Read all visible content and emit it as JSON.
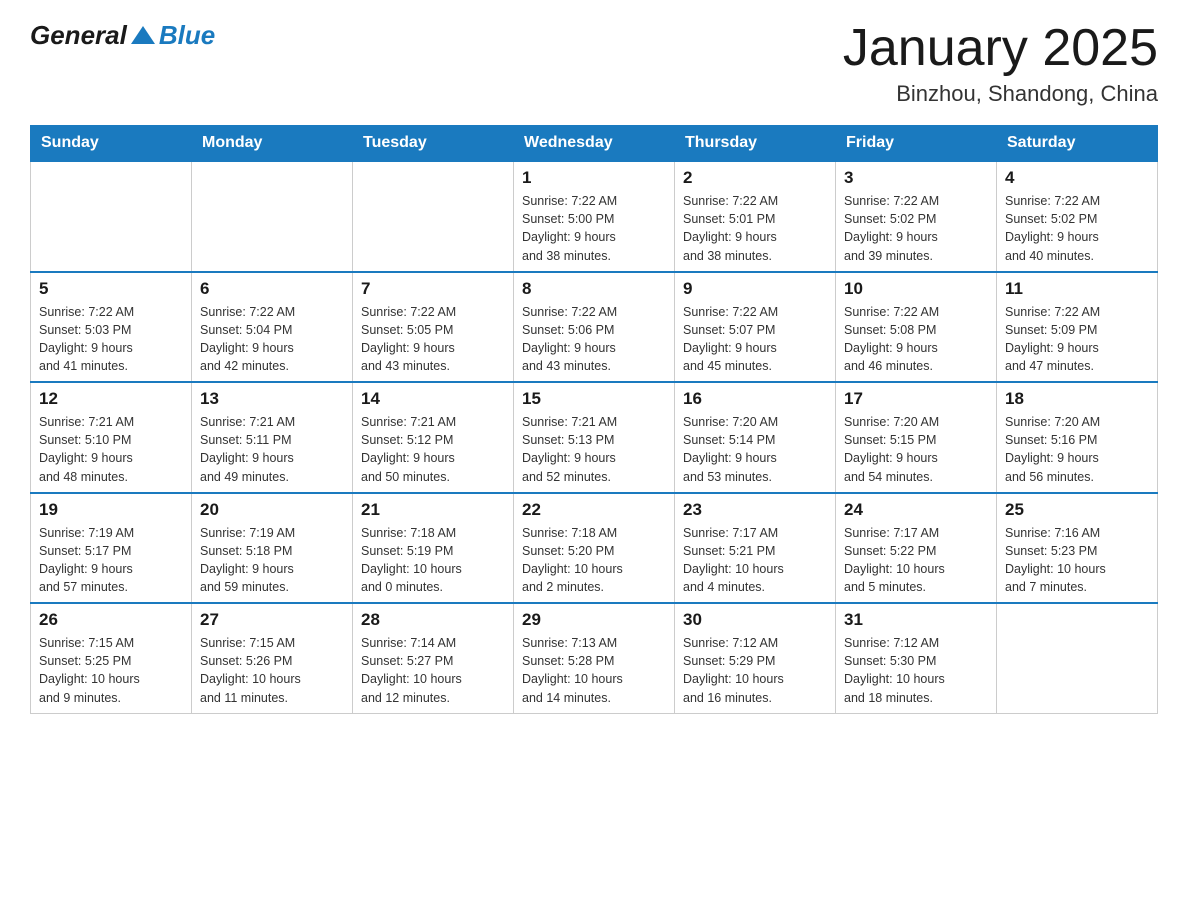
{
  "header": {
    "logo_general": "General",
    "logo_blue": "Blue",
    "title": "January 2025",
    "subtitle": "Binzhou, Shandong, China"
  },
  "weekdays": [
    "Sunday",
    "Monday",
    "Tuesday",
    "Wednesday",
    "Thursday",
    "Friday",
    "Saturday"
  ],
  "weeks": [
    [
      {
        "day": "",
        "info": ""
      },
      {
        "day": "",
        "info": ""
      },
      {
        "day": "",
        "info": ""
      },
      {
        "day": "1",
        "info": "Sunrise: 7:22 AM\nSunset: 5:00 PM\nDaylight: 9 hours\nand 38 minutes."
      },
      {
        "day": "2",
        "info": "Sunrise: 7:22 AM\nSunset: 5:01 PM\nDaylight: 9 hours\nand 38 minutes."
      },
      {
        "day": "3",
        "info": "Sunrise: 7:22 AM\nSunset: 5:02 PM\nDaylight: 9 hours\nand 39 minutes."
      },
      {
        "day": "4",
        "info": "Sunrise: 7:22 AM\nSunset: 5:02 PM\nDaylight: 9 hours\nand 40 minutes."
      }
    ],
    [
      {
        "day": "5",
        "info": "Sunrise: 7:22 AM\nSunset: 5:03 PM\nDaylight: 9 hours\nand 41 minutes."
      },
      {
        "day": "6",
        "info": "Sunrise: 7:22 AM\nSunset: 5:04 PM\nDaylight: 9 hours\nand 42 minutes."
      },
      {
        "day": "7",
        "info": "Sunrise: 7:22 AM\nSunset: 5:05 PM\nDaylight: 9 hours\nand 43 minutes."
      },
      {
        "day": "8",
        "info": "Sunrise: 7:22 AM\nSunset: 5:06 PM\nDaylight: 9 hours\nand 43 minutes."
      },
      {
        "day": "9",
        "info": "Sunrise: 7:22 AM\nSunset: 5:07 PM\nDaylight: 9 hours\nand 45 minutes."
      },
      {
        "day": "10",
        "info": "Sunrise: 7:22 AM\nSunset: 5:08 PM\nDaylight: 9 hours\nand 46 minutes."
      },
      {
        "day": "11",
        "info": "Sunrise: 7:22 AM\nSunset: 5:09 PM\nDaylight: 9 hours\nand 47 minutes."
      }
    ],
    [
      {
        "day": "12",
        "info": "Sunrise: 7:21 AM\nSunset: 5:10 PM\nDaylight: 9 hours\nand 48 minutes."
      },
      {
        "day": "13",
        "info": "Sunrise: 7:21 AM\nSunset: 5:11 PM\nDaylight: 9 hours\nand 49 minutes."
      },
      {
        "day": "14",
        "info": "Sunrise: 7:21 AM\nSunset: 5:12 PM\nDaylight: 9 hours\nand 50 minutes."
      },
      {
        "day": "15",
        "info": "Sunrise: 7:21 AM\nSunset: 5:13 PM\nDaylight: 9 hours\nand 52 minutes."
      },
      {
        "day": "16",
        "info": "Sunrise: 7:20 AM\nSunset: 5:14 PM\nDaylight: 9 hours\nand 53 minutes."
      },
      {
        "day": "17",
        "info": "Sunrise: 7:20 AM\nSunset: 5:15 PM\nDaylight: 9 hours\nand 54 minutes."
      },
      {
        "day": "18",
        "info": "Sunrise: 7:20 AM\nSunset: 5:16 PM\nDaylight: 9 hours\nand 56 minutes."
      }
    ],
    [
      {
        "day": "19",
        "info": "Sunrise: 7:19 AM\nSunset: 5:17 PM\nDaylight: 9 hours\nand 57 minutes."
      },
      {
        "day": "20",
        "info": "Sunrise: 7:19 AM\nSunset: 5:18 PM\nDaylight: 9 hours\nand 59 minutes."
      },
      {
        "day": "21",
        "info": "Sunrise: 7:18 AM\nSunset: 5:19 PM\nDaylight: 10 hours\nand 0 minutes."
      },
      {
        "day": "22",
        "info": "Sunrise: 7:18 AM\nSunset: 5:20 PM\nDaylight: 10 hours\nand 2 minutes."
      },
      {
        "day": "23",
        "info": "Sunrise: 7:17 AM\nSunset: 5:21 PM\nDaylight: 10 hours\nand 4 minutes."
      },
      {
        "day": "24",
        "info": "Sunrise: 7:17 AM\nSunset: 5:22 PM\nDaylight: 10 hours\nand 5 minutes."
      },
      {
        "day": "25",
        "info": "Sunrise: 7:16 AM\nSunset: 5:23 PM\nDaylight: 10 hours\nand 7 minutes."
      }
    ],
    [
      {
        "day": "26",
        "info": "Sunrise: 7:15 AM\nSunset: 5:25 PM\nDaylight: 10 hours\nand 9 minutes."
      },
      {
        "day": "27",
        "info": "Sunrise: 7:15 AM\nSunset: 5:26 PM\nDaylight: 10 hours\nand 11 minutes."
      },
      {
        "day": "28",
        "info": "Sunrise: 7:14 AM\nSunset: 5:27 PM\nDaylight: 10 hours\nand 12 minutes."
      },
      {
        "day": "29",
        "info": "Sunrise: 7:13 AM\nSunset: 5:28 PM\nDaylight: 10 hours\nand 14 minutes."
      },
      {
        "day": "30",
        "info": "Sunrise: 7:12 AM\nSunset: 5:29 PM\nDaylight: 10 hours\nand 16 minutes."
      },
      {
        "day": "31",
        "info": "Sunrise: 7:12 AM\nSunset: 5:30 PM\nDaylight: 10 hours\nand 18 minutes."
      },
      {
        "day": "",
        "info": ""
      }
    ]
  ]
}
